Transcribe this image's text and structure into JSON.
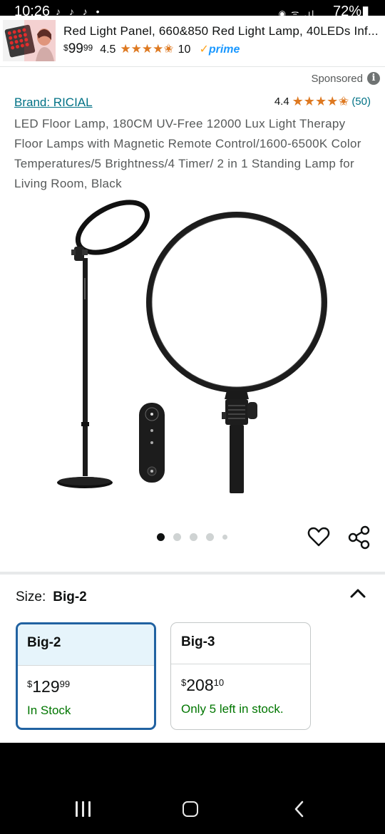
{
  "status_bar": {
    "time": "10:26",
    "notifications": "♪ ♪ ♪ •",
    "signal": "◉ ᯤ .ıl",
    "battery": "72%▮"
  },
  "sticky_ad": {
    "title": "Red Light Panel, 660&850 Red Light Lamp, 40LEDs Inf...",
    "price_currency": "$",
    "price_whole": "99",
    "price_fraction": "99",
    "rating": "4.5",
    "stars": "★★★★✬",
    "review_count": "10",
    "prime_check": "✓",
    "prime_label": "prime"
  },
  "sponsored": {
    "label": "Sponsored",
    "info_glyph": "i"
  },
  "product": {
    "brand": "Brand: RICIAL",
    "rating": "4.4",
    "stars": "★★★★✬",
    "review_count": "(50)",
    "title": "LED Floor Lamp, 180CM UV-Free 12000 Lux Light Therapy Floor Lamps with Magnetic Remote Control/1600-6500K Color Temperatures/5 Brightness/4 Timer/ 2 in 1 Standing Lamp for Living Room, Black"
  },
  "gallery": {
    "image_count": 5,
    "active_index": 0
  },
  "size": {
    "label": "Size:",
    "selected": "Big-2",
    "options": [
      {
        "name": "Big-2",
        "currency": "$",
        "whole": "129",
        "fraction": "99",
        "availability": "In Stock"
      },
      {
        "name": "Big-3",
        "currency": "$",
        "whole": "208",
        "fraction": "10",
        "availability": "Only 5 left in stock."
      }
    ]
  },
  "icons": {
    "heart": "heart-icon",
    "share": "share-icon",
    "chevron": "chevron-up-icon",
    "nav_recent": "recent-apps-icon",
    "nav_home": "home-icon",
    "nav_back": "back-icon"
  },
  "colors": {
    "link": "#007185",
    "star": "#de7921",
    "prime": "#1a98ff",
    "in_stock": "#007600",
    "selected_border": "#2162a1",
    "selected_bg": "#e6f4fb"
  }
}
